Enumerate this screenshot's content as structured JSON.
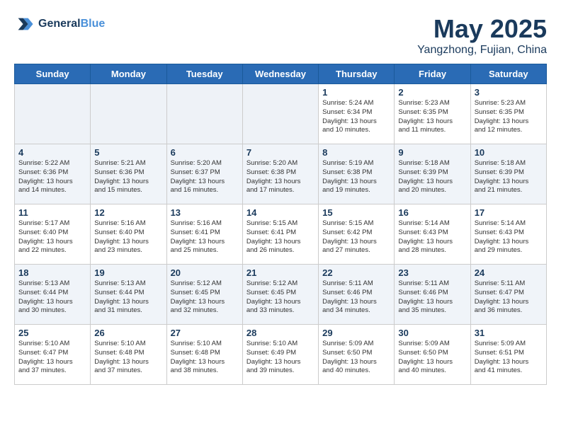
{
  "header": {
    "logo_line1": "General",
    "logo_line2": "Blue",
    "month_year": "May 2025",
    "location": "Yangzhong, Fujian, China"
  },
  "weekdays": [
    "Sunday",
    "Monday",
    "Tuesday",
    "Wednesday",
    "Thursday",
    "Friday",
    "Saturday"
  ],
  "weeks": [
    [
      {
        "day": "",
        "info": ""
      },
      {
        "day": "",
        "info": ""
      },
      {
        "day": "",
        "info": ""
      },
      {
        "day": "",
        "info": ""
      },
      {
        "day": "1",
        "info": "Sunrise: 5:24 AM\nSunset: 6:34 PM\nDaylight: 13 hours\nand 10 minutes."
      },
      {
        "day": "2",
        "info": "Sunrise: 5:23 AM\nSunset: 6:35 PM\nDaylight: 13 hours\nand 11 minutes."
      },
      {
        "day": "3",
        "info": "Sunrise: 5:23 AM\nSunset: 6:35 PM\nDaylight: 13 hours\nand 12 minutes."
      }
    ],
    [
      {
        "day": "4",
        "info": "Sunrise: 5:22 AM\nSunset: 6:36 PM\nDaylight: 13 hours\nand 14 minutes."
      },
      {
        "day": "5",
        "info": "Sunrise: 5:21 AM\nSunset: 6:36 PM\nDaylight: 13 hours\nand 15 minutes."
      },
      {
        "day": "6",
        "info": "Sunrise: 5:20 AM\nSunset: 6:37 PM\nDaylight: 13 hours\nand 16 minutes."
      },
      {
        "day": "7",
        "info": "Sunrise: 5:20 AM\nSunset: 6:38 PM\nDaylight: 13 hours\nand 17 minutes."
      },
      {
        "day": "8",
        "info": "Sunrise: 5:19 AM\nSunset: 6:38 PM\nDaylight: 13 hours\nand 19 minutes."
      },
      {
        "day": "9",
        "info": "Sunrise: 5:18 AM\nSunset: 6:39 PM\nDaylight: 13 hours\nand 20 minutes."
      },
      {
        "day": "10",
        "info": "Sunrise: 5:18 AM\nSunset: 6:39 PM\nDaylight: 13 hours\nand 21 minutes."
      }
    ],
    [
      {
        "day": "11",
        "info": "Sunrise: 5:17 AM\nSunset: 6:40 PM\nDaylight: 13 hours\nand 22 minutes."
      },
      {
        "day": "12",
        "info": "Sunrise: 5:16 AM\nSunset: 6:40 PM\nDaylight: 13 hours\nand 23 minutes."
      },
      {
        "day": "13",
        "info": "Sunrise: 5:16 AM\nSunset: 6:41 PM\nDaylight: 13 hours\nand 25 minutes."
      },
      {
        "day": "14",
        "info": "Sunrise: 5:15 AM\nSunset: 6:41 PM\nDaylight: 13 hours\nand 26 minutes."
      },
      {
        "day": "15",
        "info": "Sunrise: 5:15 AM\nSunset: 6:42 PM\nDaylight: 13 hours\nand 27 minutes."
      },
      {
        "day": "16",
        "info": "Sunrise: 5:14 AM\nSunset: 6:43 PM\nDaylight: 13 hours\nand 28 minutes."
      },
      {
        "day": "17",
        "info": "Sunrise: 5:14 AM\nSunset: 6:43 PM\nDaylight: 13 hours\nand 29 minutes."
      }
    ],
    [
      {
        "day": "18",
        "info": "Sunrise: 5:13 AM\nSunset: 6:44 PM\nDaylight: 13 hours\nand 30 minutes."
      },
      {
        "day": "19",
        "info": "Sunrise: 5:13 AM\nSunset: 6:44 PM\nDaylight: 13 hours\nand 31 minutes."
      },
      {
        "day": "20",
        "info": "Sunrise: 5:12 AM\nSunset: 6:45 PM\nDaylight: 13 hours\nand 32 minutes."
      },
      {
        "day": "21",
        "info": "Sunrise: 5:12 AM\nSunset: 6:45 PM\nDaylight: 13 hours\nand 33 minutes."
      },
      {
        "day": "22",
        "info": "Sunrise: 5:11 AM\nSunset: 6:46 PM\nDaylight: 13 hours\nand 34 minutes."
      },
      {
        "day": "23",
        "info": "Sunrise: 5:11 AM\nSunset: 6:46 PM\nDaylight: 13 hours\nand 35 minutes."
      },
      {
        "day": "24",
        "info": "Sunrise: 5:11 AM\nSunset: 6:47 PM\nDaylight: 13 hours\nand 36 minutes."
      }
    ],
    [
      {
        "day": "25",
        "info": "Sunrise: 5:10 AM\nSunset: 6:47 PM\nDaylight: 13 hours\nand 37 minutes."
      },
      {
        "day": "26",
        "info": "Sunrise: 5:10 AM\nSunset: 6:48 PM\nDaylight: 13 hours\nand 37 minutes."
      },
      {
        "day": "27",
        "info": "Sunrise: 5:10 AM\nSunset: 6:48 PM\nDaylight: 13 hours\nand 38 minutes."
      },
      {
        "day": "28",
        "info": "Sunrise: 5:10 AM\nSunset: 6:49 PM\nDaylight: 13 hours\nand 39 minutes."
      },
      {
        "day": "29",
        "info": "Sunrise: 5:09 AM\nSunset: 6:50 PM\nDaylight: 13 hours\nand 40 minutes."
      },
      {
        "day": "30",
        "info": "Sunrise: 5:09 AM\nSunset: 6:50 PM\nDaylight: 13 hours\nand 40 minutes."
      },
      {
        "day": "31",
        "info": "Sunrise: 5:09 AM\nSunset: 6:51 PM\nDaylight: 13 hours\nand 41 minutes."
      }
    ]
  ]
}
